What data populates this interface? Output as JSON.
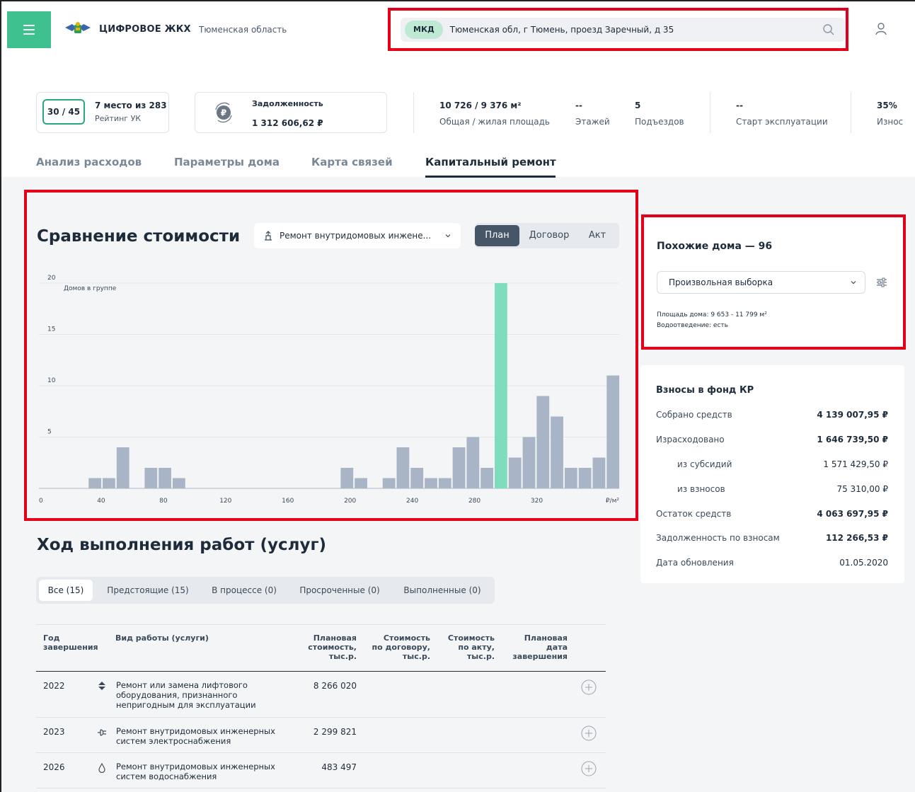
{
  "header": {
    "brand": "ЦИФРОВОЕ ЖКХ",
    "region": "Тюменская область",
    "search": {
      "badge": "МКД",
      "value": "Тюменская обл, г Тюмень, проезд Заречный, д 35"
    }
  },
  "stats": {
    "rating": {
      "badge": "30 / 45",
      "place": "7 место из 283",
      "label": "Рейтинг УК"
    },
    "debt": {
      "label": "Задолженность",
      "value": "1 312 606,62 ₽"
    },
    "area": {
      "value": "10 726 / 9 376 м²",
      "label": "Общая / жилая площадь"
    },
    "floors": {
      "value": "--",
      "label": "Этажей"
    },
    "entrances": {
      "value": "5",
      "label": "Подъездов"
    },
    "start": {
      "value": "--",
      "label": "Старт эксплуатации"
    },
    "wear": {
      "value": "35%",
      "label": "Износ"
    }
  },
  "tabs": [
    "Анализ расходов",
    "Параметры дома",
    "Карта связей",
    "Капитальный ремонт"
  ],
  "comparison": {
    "title": "Сравнение стоимости",
    "work_select": "Ремонт внутридомовых инжене...",
    "segments": [
      "План",
      "Договор",
      "Акт"
    ],
    "active_segment": "План"
  },
  "chart_data": {
    "type": "bar",
    "ylabel": "Домов в группе",
    "xunit": "₽/м²",
    "ylim": [
      0,
      20
    ],
    "yticks": [
      5,
      10,
      15,
      20
    ],
    "xticks": [
      0,
      40,
      80,
      120,
      160,
      200,
      240,
      280,
      320
    ],
    "bar_width": 9,
    "values": [
      {
        "x": 36,
        "y": 1,
        "highlight": false
      },
      {
        "x": 45,
        "y": 1,
        "highlight": false
      },
      {
        "x": 54,
        "y": 4,
        "highlight": false
      },
      {
        "x": 72,
        "y": 2,
        "highlight": false
      },
      {
        "x": 81,
        "y": 2,
        "highlight": false
      },
      {
        "x": 90,
        "y": 1,
        "highlight": false
      },
      {
        "x": 198,
        "y": 2,
        "highlight": false
      },
      {
        "x": 207,
        "y": 1,
        "highlight": false
      },
      {
        "x": 225,
        "y": 1,
        "highlight": false
      },
      {
        "x": 234,
        "y": 4,
        "highlight": false
      },
      {
        "x": 243,
        "y": 2,
        "highlight": false
      },
      {
        "x": 252,
        "y": 1,
        "highlight": false
      },
      {
        "x": 261,
        "y": 1,
        "highlight": false
      },
      {
        "x": 270,
        "y": 4,
        "highlight": false
      },
      {
        "x": 279,
        "y": 5,
        "highlight": false
      },
      {
        "x": 288,
        "y": 2,
        "highlight": false
      },
      {
        "x": 297,
        "y": 20,
        "highlight": true
      },
      {
        "x": 306,
        "y": 3,
        "highlight": false
      },
      {
        "x": 315,
        "y": 5,
        "highlight": false
      },
      {
        "x": 324,
        "y": 9,
        "highlight": false
      },
      {
        "x": 333,
        "y": 7,
        "highlight": false
      },
      {
        "x": 342,
        "y": 2,
        "highlight": false
      },
      {
        "x": 351,
        "y": 2,
        "highlight": false
      },
      {
        "x": 360,
        "y": 3,
        "highlight": false
      },
      {
        "x": 369,
        "y": 11,
        "highlight": false
      }
    ],
    "colors": {
      "bar": "#a9b5c7",
      "highlight": "#7fdcbd"
    }
  },
  "similar": {
    "title": "Похожие дома — 96",
    "select": "Произвольная выборка",
    "note_area": "Площадь дома: 9 653 - 11 799 м²",
    "note_drain": "Водоотведение: есть"
  },
  "fund": {
    "title": "Взносы в фонд КР",
    "rows": [
      {
        "label": "Собрано средств",
        "value": "4 139 007,95 ₽"
      },
      {
        "label": "Израсходовано",
        "value": "1 646 739,50 ₽"
      },
      {
        "label": "из субсидий",
        "value": "1 571 429,50 ₽"
      },
      {
        "label": "из взносов",
        "value": "75 310,00 ₽"
      },
      {
        "label": "Остаток средств",
        "value": "4 063 697,95 ₽"
      },
      {
        "label": "Задолженность по взносам",
        "value": "112 266,53 ₽"
      },
      {
        "label": "Дата обновления",
        "value": "01.05.2020"
      }
    ]
  },
  "progress": {
    "title": "Ход выполнения работ (услуг)",
    "tabs": [
      "Все (15)",
      "Предстоящие (15)",
      "В процессе (0)",
      "Просроченные (0)",
      "Выполненные (0)"
    ],
    "columns": {
      "year": [
        "Год",
        "завершения"
      ],
      "work": [
        "Вид работы (услуги)"
      ],
      "plan": [
        "Плановая",
        "стоимость,",
        "тыс.р."
      ],
      "contract": [
        "Стоимость",
        "по договору,",
        "тыс.р."
      ],
      "act": [
        "Стоимость",
        "по акту,",
        "тыс.р."
      ],
      "date": [
        "Плановая",
        "дата",
        "завершения"
      ]
    },
    "rows": [
      {
        "year": "2022",
        "icon": "elevator-icon",
        "work": [
          "Ремонт или замена лифтового",
          "оборудования, признанного",
          "непригодным для эксплуатации"
        ],
        "plan": "8 266 020"
      },
      {
        "year": "2023",
        "icon": "power-plug-icon",
        "work": [
          "Ремонт внутридомовых инженерных",
          "систем электроснабжения"
        ],
        "plan": "2 299 821"
      },
      {
        "year": "2026",
        "icon": "water-drop-icon",
        "work": [
          "Ремонт внутридомовых инженерных",
          "систем водоснабжения"
        ],
        "plan": "483 497"
      }
    ]
  }
}
